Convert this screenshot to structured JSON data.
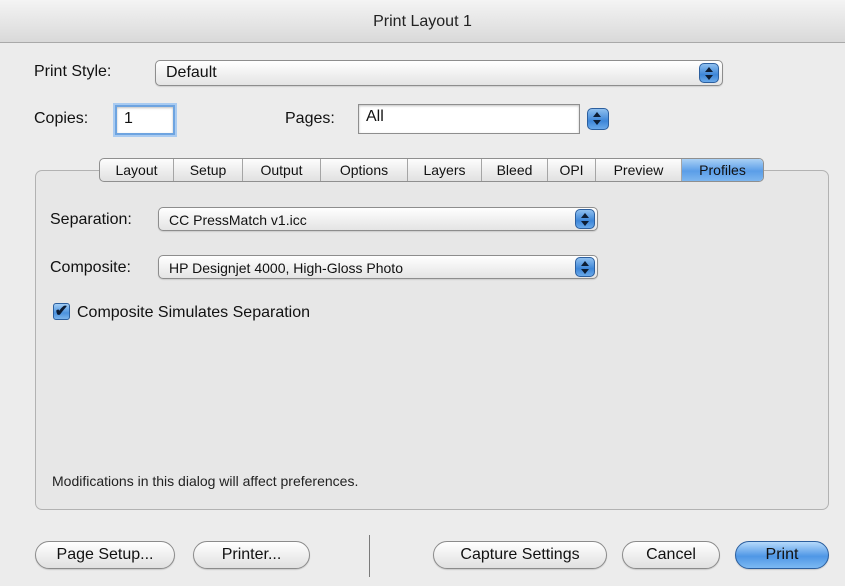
{
  "window": {
    "title": "Print Layout 1"
  },
  "print_style": {
    "label": "Print Style:",
    "value": "Default"
  },
  "copies": {
    "label": "Copies:",
    "value": "1"
  },
  "pages": {
    "label": "Pages:",
    "value": "All"
  },
  "tabs": [
    {
      "label": "Layout",
      "active": false
    },
    {
      "label": "Setup",
      "active": false
    },
    {
      "label": "Output",
      "active": false
    },
    {
      "label": "Options",
      "active": false
    },
    {
      "label": "Layers",
      "active": false
    },
    {
      "label": "Bleed",
      "active": false
    },
    {
      "label": "OPI",
      "active": false
    },
    {
      "label": "Preview",
      "active": false
    },
    {
      "label": "Profiles",
      "active": true
    }
  ],
  "profiles": {
    "separation": {
      "label": "Separation:",
      "value": "CC PressMatch v1.icc"
    },
    "composite": {
      "label": "Composite:",
      "value": "HP Designjet 4000, High-Gloss Photo"
    },
    "simulate": {
      "label": "Composite Simulates Separation",
      "checked": true,
      "mark": "✔"
    },
    "note": "Modifications in this dialog will affect preferences."
  },
  "buttons": {
    "page_setup": "Page Setup...",
    "printer": "Printer...",
    "capture": "Capture Settings",
    "cancel": "Cancel",
    "print": "Print"
  },
  "colors": {
    "accent": "#5b9ee8",
    "window_bg": "#ececec"
  }
}
